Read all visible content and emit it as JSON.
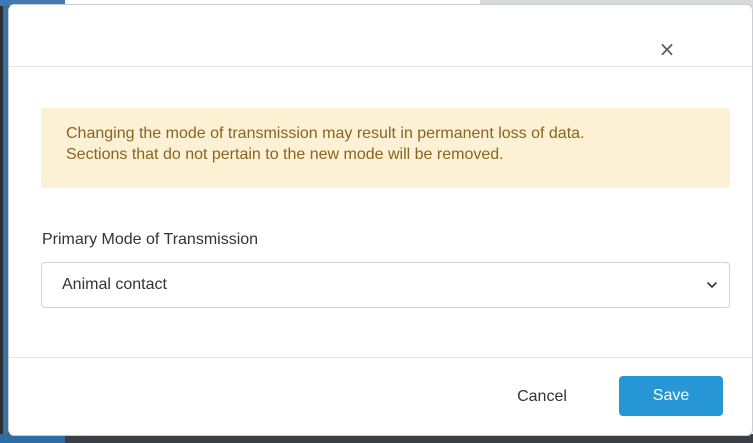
{
  "dialog": {
    "close_glyph": "×",
    "alert": {
      "line1": "Changing the mode of transmission may result in permanent loss of data.",
      "line2": "Sections that do not pertain to the new mode will be removed."
    },
    "field": {
      "label": "Primary Mode of Transmission",
      "selected_value": "Animal contact",
      "icon": "chevron-down-icon"
    },
    "footer": {
      "cancel_label": "Cancel",
      "save_label": "Save"
    }
  },
  "colors": {
    "alert_background": "#fcf1d4",
    "alert_text": "#8a6420",
    "primary_button": "#2796d5"
  }
}
